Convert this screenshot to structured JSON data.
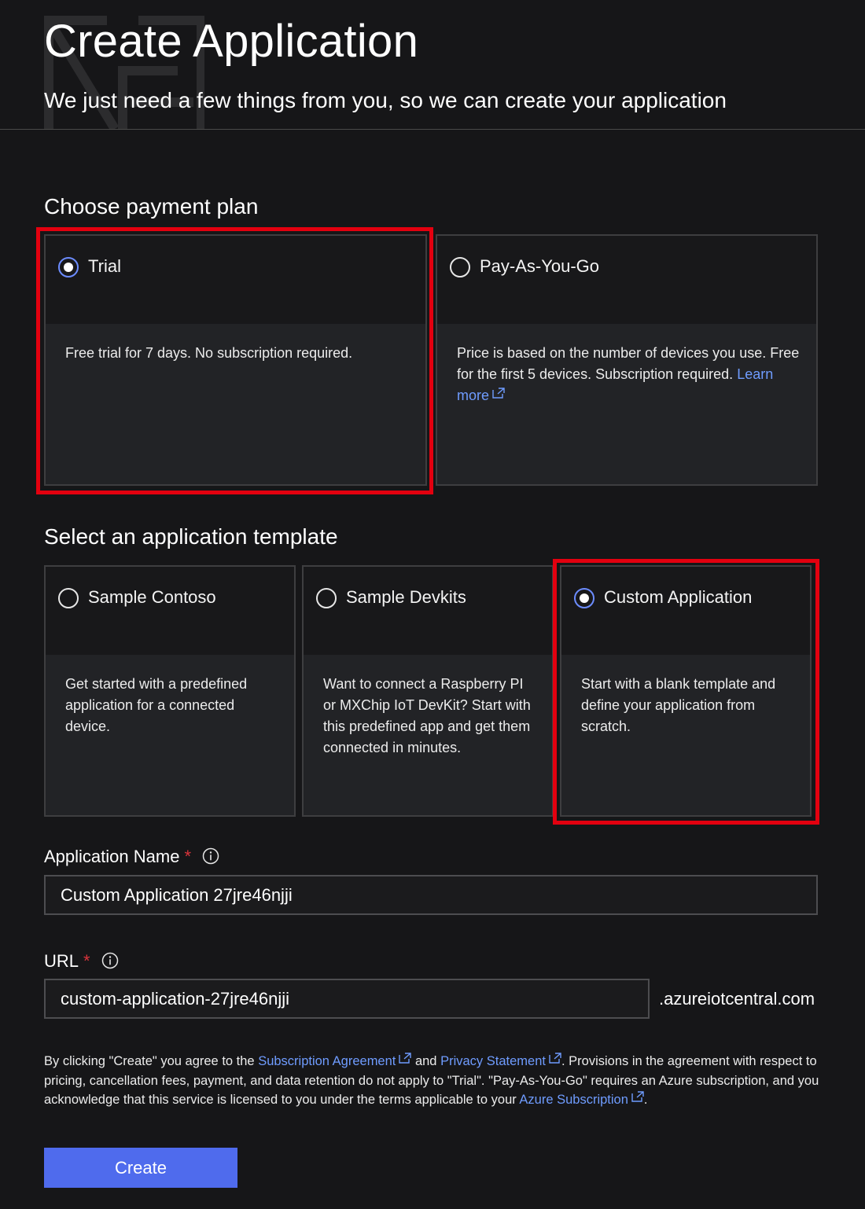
{
  "header": {
    "title": "Create Application",
    "subtitle": "We just need a few things from you, so we can create your application"
  },
  "payment_plan": {
    "heading": "Choose payment plan",
    "options": [
      {
        "label": "Trial",
        "selected": true,
        "description": "Free trial for 7 days. No subscription required."
      },
      {
        "label": "Pay-As-You-Go",
        "selected": false,
        "description": "Price is based on the number of devices you use. Free for the first 5 devices. Subscription required.",
        "link": "Learn more"
      }
    ]
  },
  "template": {
    "heading": "Select an application template",
    "options": [
      {
        "label": "Sample Contoso",
        "selected": false,
        "description": "Get started with a predefined application for a connected device."
      },
      {
        "label": "Sample Devkits",
        "selected": false,
        "description": "Want to connect a Raspberry PI or MXChip IoT DevKit? Start with this predefined app and get them connected in minutes."
      },
      {
        "label": "Custom Application",
        "selected": true,
        "description": "Start with a blank template and define your application from scratch."
      }
    ]
  },
  "form": {
    "app_name_label": "Application Name",
    "app_name_value": "Custom Application 27jre46njji",
    "url_label": "URL",
    "url_value": "custom-application-27jre46njji",
    "url_suffix": ".azureiotcentral.com",
    "required_mark": "*"
  },
  "terms": {
    "part1": "By clicking \"Create\" you agree to the ",
    "link1": "Subscription Agreement",
    "part2": " and ",
    "link2": "Privacy Statement",
    "part3": ". Provisions in the agreement with respect to pricing, cancellation fees, payment, and data retention do not apply to \"Trial\". \"Pay-As-You-Go\" requires an Azure subscription, and you acknowledge that this service is licensed to you under the terms applicable to your ",
    "link3": "Azure Subscription",
    "part4": "."
  },
  "actions": {
    "create_label": "Create"
  },
  "colors": {
    "accent": "#4f6bed",
    "link": "#6f9cff",
    "highlight": "#e3000f",
    "required": "#d9343b"
  }
}
